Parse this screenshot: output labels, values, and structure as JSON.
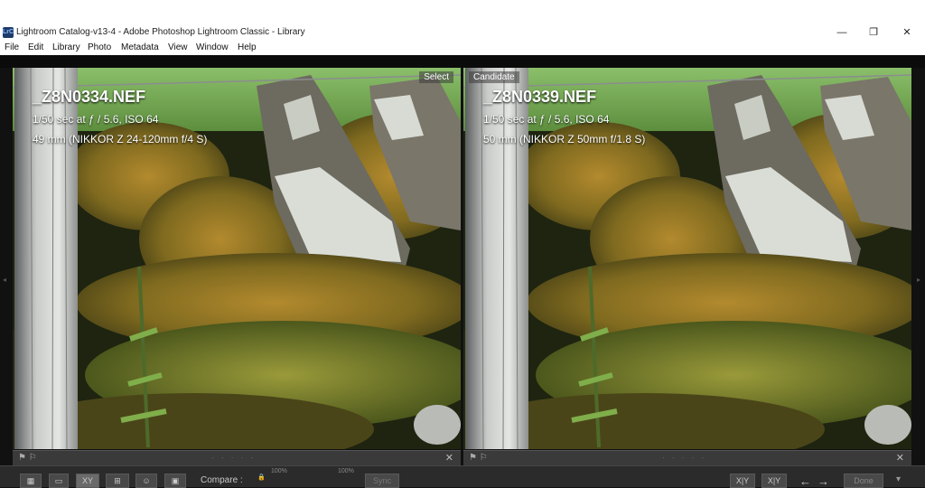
{
  "window": {
    "title": "Lightroom Catalog-v13-4 - Adobe Photoshop Lightroom Classic - Library",
    "app_icon_text": "LrC",
    "minimize_symbol": "—",
    "restore_symbol": "❐",
    "close_symbol": "✕"
  },
  "menu": [
    "File",
    "Edit",
    "Library",
    "Photo",
    "Metadata",
    "View",
    "Window",
    "Help"
  ],
  "left_photo": {
    "badge": "Select",
    "filename": "_Z8N0334.NEF",
    "exposure": "1/50 sec at ƒ / 5.6, ISO 64",
    "lens": "49 mm (NIKKOR Z 24-120mm f/4 S)"
  },
  "right_photo": {
    "badge": "Candidate",
    "filename": "_Z8N0339.NEF",
    "exposure": "1/50 sec at ƒ / 5.6, ISO 64",
    "lens": "50 mm (NIKKOR Z 50mm f/1.8 S)"
  },
  "panel": {
    "flag_symbol": "⚑ ⚐",
    "dots": "· · · · ·",
    "close_symbol": "✕"
  },
  "toolbar": {
    "grid_icon": "▦",
    "loupe_icon": "▭",
    "compare_icon": "XY",
    "survey_icon": "⊞",
    "people_icon": "☺",
    "secondary_icon": "▣",
    "compare_label": "Compare :",
    "lock_icon": "🔒",
    "zoom_left": "100%",
    "zoom_right": "100%",
    "sync_label": "Sync",
    "swap_left": "X|Y",
    "swap_right": "X|Y",
    "prev_arrow": "←",
    "next_arrow": "→",
    "done_label": "Done",
    "menu_arrow": "▾"
  },
  "colors": {
    "select_accent": "#ffffff",
    "background": "#111111",
    "toolbar_bg": "#2b2b2b"
  }
}
